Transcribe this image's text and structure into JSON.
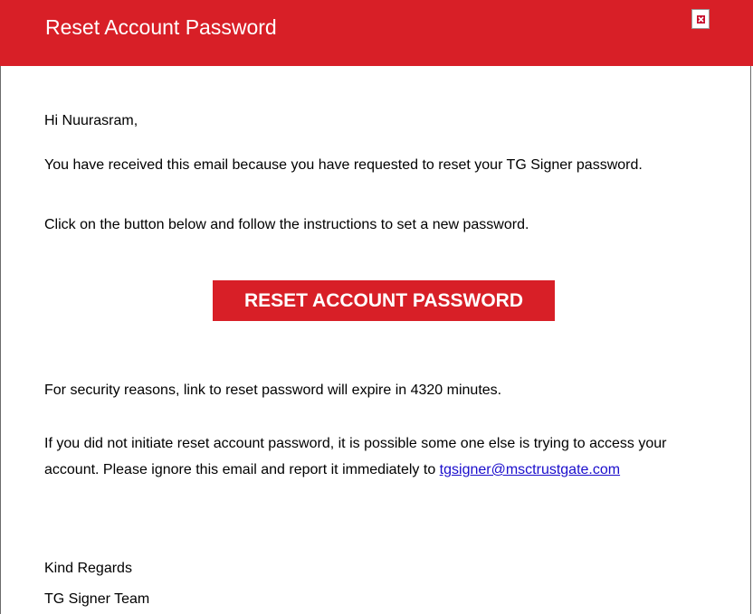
{
  "header": {
    "title": "Reset Account Password",
    "close_icon": "close-icon",
    "color": "#d81f27"
  },
  "email": {
    "greeting": "Hi Nuurasram,",
    "paragraph1": "You have received this email because you have requested to reset your TG Signer password.",
    "paragraph2": "Click on the button below and follow the instructions to set a new password.",
    "button_label": "RESET ACCOUNT PASSWORD",
    "security_note": "For security reasons, link to reset password will expire in 4320 minutes.",
    "warning_text": "If you did not initiate reset account password, it is possible some one else is trying to access your account. Please ignore this email and report it immediately to",
    "support_email": "tgsigner@msctrustgate.com",
    "closing": "Kind Regards",
    "signature": "TG Signer Team"
  },
  "link_color": "#1a0dcc"
}
